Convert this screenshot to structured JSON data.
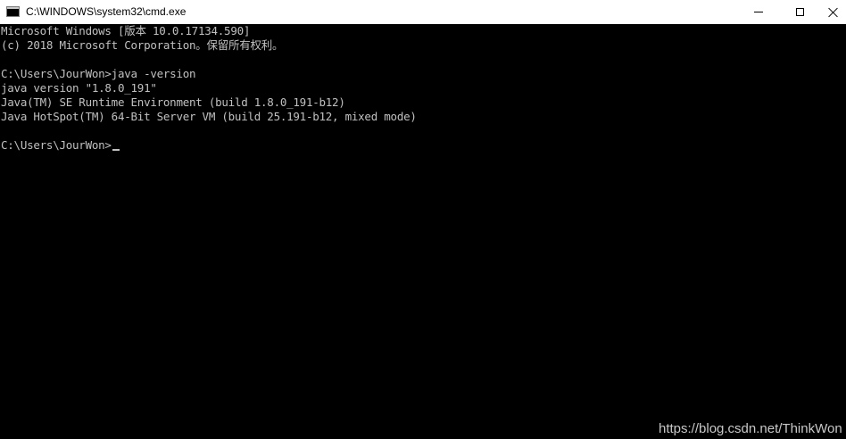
{
  "window": {
    "title": "C:\\WINDOWS\\system32\\cmd.exe",
    "icon": "cmd-console-icon",
    "controls": {
      "minimize_icon": "minimize-icon",
      "maximize_icon": "maximize-icon",
      "close_icon": "close-icon"
    }
  },
  "console": {
    "background": "#000000",
    "foreground": "#c0c0c0",
    "lines": [
      "Microsoft Windows [版本 10.0.17134.590]",
      "(c) 2018 Microsoft Corporation。保留所有权利。",
      "",
      "C:\\Users\\JourWon>java -version",
      "java version \"1.8.0_191\"",
      "Java(TM) SE Runtime Environment (build 1.8.0_191-b12)",
      "Java HotSpot(TM) 64-Bit Server VM (build 25.191-b12, mixed mode)",
      "",
      "C:\\Users\\JourWon>"
    ]
  },
  "watermark": {
    "text": "https://blog.csdn.net/ThinkWon"
  }
}
